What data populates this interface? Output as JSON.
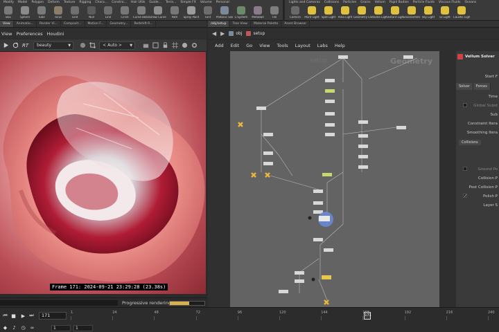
{
  "shelf": {
    "tabs_left": [
      "Modify",
      "Model",
      "Polygon",
      "Deform",
      "Texture",
      "Rigging",
      "Chara...",
      "Constra...",
      "Hair Utils",
      "Guide...",
      "Terra...",
      "Simple FX",
      "Volume",
      "Personal"
    ],
    "tabs_right": [
      "Lights and Cameras",
      "Collisions",
      "Particles",
      "Grains",
      "Vellum",
      "Rigid Bodies",
      "Particle Fluids",
      "Viscous Fluids",
      "Oceans"
    ],
    "tools_left": [
      {
        "label": "Box",
        "color": "#7a7a7a"
      },
      {
        "label": "Sphere",
        "color": "#8a8a8a"
      },
      {
        "label": "Tube",
        "color": "#7a7a7a"
      },
      {
        "label": "Torus",
        "color": "#8b7d6a"
      },
      {
        "label": "Grid",
        "color": "#6f6f6f"
      },
      {
        "label": "Null",
        "color": "#5b5b5b"
      },
      {
        "label": "Line",
        "color": "#6d6d6d"
      },
      {
        "label": "Circle",
        "color": "#777"
      },
      {
        "label": "Curve Bezier",
        "color": "#7d7d7d"
      },
      {
        "label": "Draw Curve",
        "color": "#8d8d8d"
      },
      {
        "label": "Path",
        "color": "#777"
      },
      {
        "label": "Spray Paint",
        "color": "#9b9b9b"
      },
      {
        "label": "Font",
        "color": "#6d6d6d"
      },
      {
        "label": "Platonic Solids",
        "color": "#7a8a9a"
      },
      {
        "label": "L-System",
        "color": "#6a8a6a"
      },
      {
        "label": "Metaball",
        "color": "#8a7a8a"
      },
      {
        "label": "File",
        "color": "#7d7d7d"
      }
    ],
    "tools_right": [
      {
        "label": "Camera",
        "color": "#6a6a6a"
      },
      {
        "label": "Point Light",
        "color": "#e0c040"
      },
      {
        "label": "Spot Light",
        "color": "#e0c040"
      },
      {
        "label": "Area Light",
        "color": "#e0c040"
      },
      {
        "label": "Geometry Light",
        "color": "#e0c040"
      },
      {
        "label": "Volume Light",
        "color": "#e0c040"
      },
      {
        "label": "Distant Light",
        "color": "#e0c040"
      },
      {
        "label": "Environment Light",
        "color": "#e0c040"
      },
      {
        "label": "Sky Light",
        "color": "#e0c040"
      },
      {
        "label": "GI Light",
        "color": "#e0c040"
      },
      {
        "label": "Caustic Light",
        "color": "#e0c040"
      }
    ]
  },
  "left_pane": {
    "tabs": [
      "View",
      "Animatio...",
      "Render Vi...",
      "Composit...",
      "Motion F...",
      "Geometry...",
      "Redshift R..."
    ],
    "active_tab": 0,
    "menu": [
      "View",
      "Preferences",
      "Houdini"
    ],
    "toolbar": {
      "rt_label": "RT",
      "aov_value": "beauty",
      "camera_value": "< Auto >"
    },
    "frame_info": "Frame  171:  2024-09-21  23:29:28  (23.38s)",
    "progress_label": "Progressive rendering",
    "progress_fraction": 0.55
  },
  "network": {
    "tabs": [
      "/obj/setup",
      "Tree View",
      "Material Palette",
      "Asset Browser"
    ],
    "active_tab": 0,
    "path": [
      "obj",
      "setup"
    ],
    "menu": [
      "Add",
      "Edit",
      "Go",
      "View",
      "Tools",
      "Layout",
      "Labs",
      "Help"
    ],
    "context_label": "Geometry",
    "context_faint": "setup"
  },
  "params": {
    "node_title": "Vellum Solver",
    "tabs": [
      "Solver",
      "Forces"
    ],
    "rows": [
      "Start F",
      "Time",
      "Global Subst",
      "Sub",
      "Constraint Itera",
      "Smoothing Itera",
      "Ground Po",
      "Collision P",
      "Post Collision P",
      "Polish P",
      "Layer S"
    ],
    "subtab": "Collisions"
  },
  "timeline": {
    "current_frame": "171",
    "tick_labels": [
      "1",
      "24",
      "48",
      "72",
      "96",
      "120",
      "144",
      "168",
      "192",
      "216",
      "240"
    ],
    "cursor_label": "171",
    "start_value": "1",
    "end_value": "1"
  }
}
